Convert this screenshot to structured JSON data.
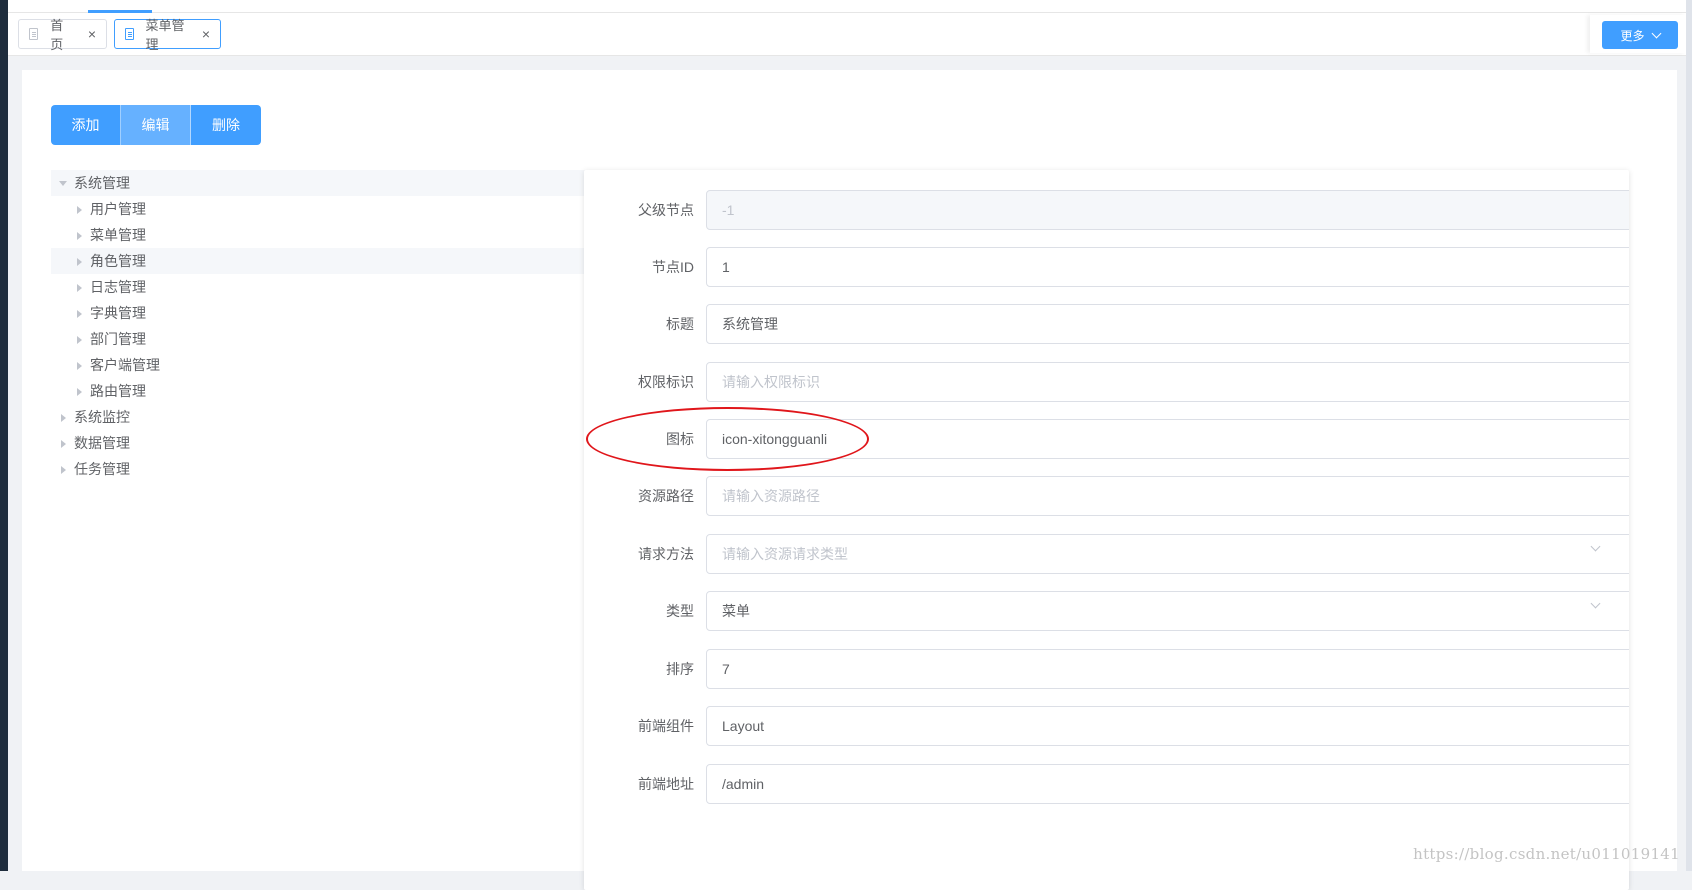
{
  "tabs": [
    {
      "label": "首页",
      "close": "×"
    },
    {
      "label": "菜单管理",
      "close": "×"
    }
  ],
  "more_button": {
    "label": "更多"
  },
  "actions": {
    "add": "添加",
    "edit": "编辑",
    "delete": "删除"
  },
  "tree": {
    "root": "系统管理",
    "children": [
      "用户管理",
      "菜单管理",
      "角色管理",
      "日志管理",
      "字典管理",
      "部门管理",
      "客户端管理",
      "路由管理"
    ],
    "siblings": [
      "系统监控",
      "数据管理",
      "任务管理"
    ]
  },
  "form": {
    "parent": {
      "label": "父级节点",
      "value": "-1"
    },
    "node_id": {
      "label": "节点ID",
      "value": "1"
    },
    "title": {
      "label": "标题",
      "value": "系统管理"
    },
    "permission": {
      "label": "权限标识",
      "placeholder": "请输入权限标识"
    },
    "icon": {
      "label": "图标",
      "value": "icon-xitongguanli"
    },
    "resource_path": {
      "label": "资源路径",
      "placeholder": "请输入资源路径"
    },
    "request_method": {
      "label": "请求方法",
      "placeholder": "请输入资源请求类型"
    },
    "type": {
      "label": "类型",
      "value": "菜单"
    },
    "sort": {
      "label": "排序",
      "value": "7"
    },
    "component": {
      "label": "前端组件",
      "value": "Layout"
    },
    "frontend_path": {
      "label": "前端地址",
      "value": "/admin"
    }
  },
  "watermark": "https://blog.csdn.net/u011019141",
  "colors": {
    "primary": "#409eff",
    "annotation": "#e0161b"
  }
}
